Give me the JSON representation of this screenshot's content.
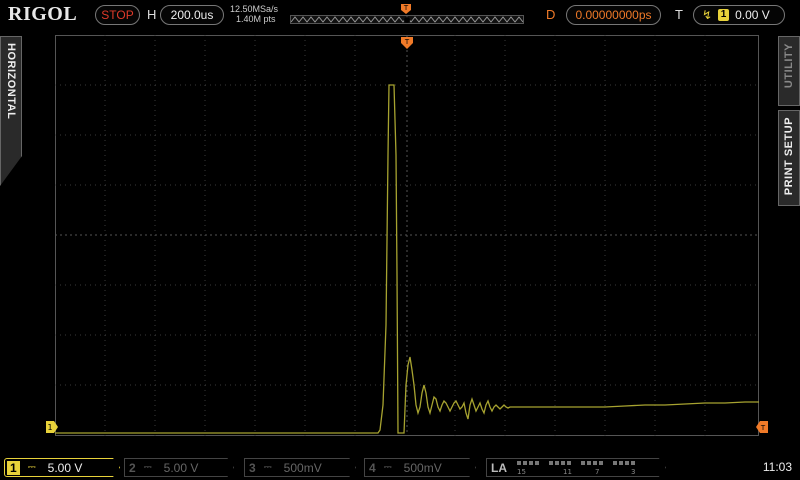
{
  "header": {
    "brand": "RIGOL",
    "run_state": "STOP",
    "h_label": "H",
    "timebase": "200.0us",
    "sample_rate": "12.50MSa/s",
    "memory_points": "1.40M pts",
    "d_label": "D",
    "delay": "0.00000000ps",
    "t_label": "T",
    "trigger_channel": "1",
    "trigger_level": "0.00 V"
  },
  "side_tabs": {
    "left": "HORIZONTAL",
    "right_top": "UTILITY",
    "right_bottom": "PRINT SETUP"
  },
  "channels": [
    {
      "num": "1",
      "coupling": "⎓",
      "scale": "5.00 V",
      "active": true,
      "color": "#e8d23a"
    },
    {
      "num": "2",
      "coupling": "⎓",
      "scale": "5.00 V",
      "active": false
    },
    {
      "num": "3",
      "coupling": "⎓",
      "scale": "500mV",
      "active": false
    },
    {
      "num": "4",
      "coupling": "⎓",
      "scale": "500mV",
      "active": false
    }
  ],
  "la": {
    "label": "LA",
    "ticks": [
      "15",
      "11",
      "7",
      "3"
    ]
  },
  "clock": "11:03",
  "colors": {
    "ch1": "#e8d23a",
    "trigger": "#f07a28",
    "stop": "#e03a2a"
  }
}
